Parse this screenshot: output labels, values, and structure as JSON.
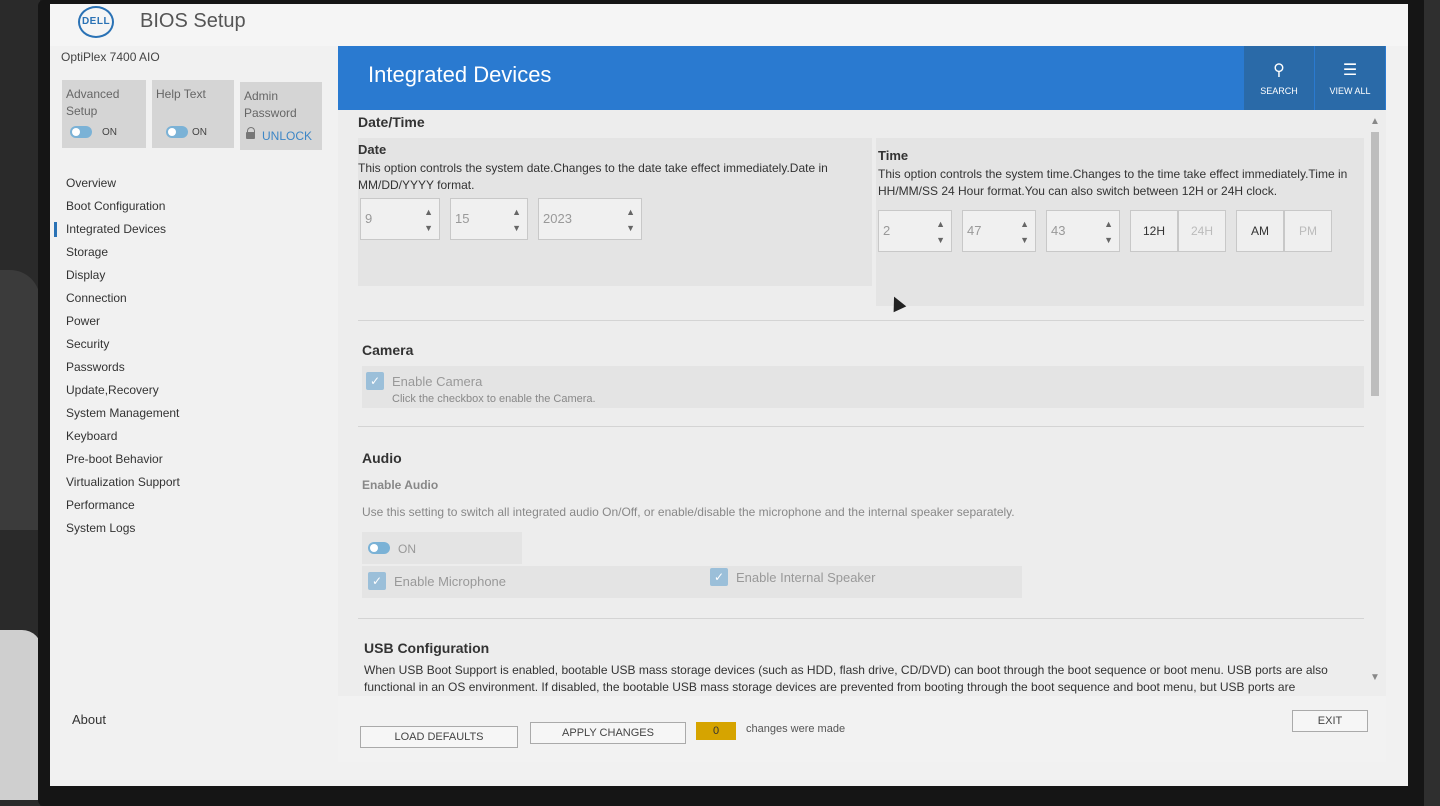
{
  "header": {
    "logo_text": "DELL",
    "title": "BIOS Setup"
  },
  "sidebar": {
    "model": "OptiPlex 7400 AIO",
    "tiles": [
      {
        "label": "Advanced Setup",
        "state": "ON"
      },
      {
        "label": "Help Text",
        "state": "ON"
      },
      {
        "label": "Admin Password",
        "action": "UNLOCK"
      }
    ],
    "items": [
      {
        "label": "Overview"
      },
      {
        "label": "Boot Configuration"
      },
      {
        "label": "Integrated Devices"
      },
      {
        "label": "Storage"
      },
      {
        "label": "Display"
      },
      {
        "label": "Connection"
      },
      {
        "label": "Power"
      },
      {
        "label": "Security"
      },
      {
        "label": "Passwords"
      },
      {
        "label": "Update,Recovery"
      },
      {
        "label": "System Management"
      },
      {
        "label": "Keyboard"
      },
      {
        "label": "Pre-boot Behavior"
      },
      {
        "label": "Virtualization Support"
      },
      {
        "label": "Performance"
      },
      {
        "label": "System Logs"
      }
    ],
    "active_item": "Integrated Devices",
    "about": "About"
  },
  "main": {
    "title": "Integrated Devices",
    "search_label": "SEARCH",
    "view_all_label": "VIEW ALL",
    "datetime": {
      "section_title": "Date/Time",
      "date_title": "Date",
      "date_desc": "This option controls the system date.Changes to the date take effect immediately.Date in MM/DD/YYYY format.",
      "month": "9",
      "day": "15",
      "year": "2023",
      "time_title": "Time",
      "time_desc": "This option controls the system time.Changes to the time take effect immediately.Time in HH/MM/SS 24 Hour format.You can also switch between 12H or 24H clock.",
      "hour": "2",
      "minute": "47",
      "second": "43",
      "fmt_12": "12H",
      "fmt_24": "24H",
      "am": "AM",
      "pm": "PM"
    },
    "camera": {
      "section_title": "Camera",
      "enable_label": "Enable Camera",
      "enable_desc": "Click the checkbox to enable the Camera."
    },
    "audio": {
      "section_title": "Audio",
      "field_title": "Enable Audio",
      "desc": "Use this setting to switch all integrated audio On/Off, or enable/disable the microphone and the internal speaker separately.",
      "toggle_state": "ON",
      "mic_label": "Enable Microphone",
      "speaker_label": "Enable Internal Speaker"
    },
    "usb": {
      "section_title": "USB Configuration",
      "desc_line1": "When USB Boot Support is enabled, bootable USB mass storage devices (such as HDD, flash drive, CD/DVD) can boot through the boot sequence or boot menu. USB ports are also",
      "desc_line2": "functional in an OS environment. If disabled, the bootable USB mass storage devices are prevented from booting through the boot sequence and boot menu, but USB ports are"
    }
  },
  "footer": {
    "load_defaults": "LOAD DEFAULTS",
    "apply_changes": "APPLY CHANGES",
    "change_count": "0",
    "change_text": "changes were made",
    "exit": "EXIT"
  },
  "colors": {
    "header_blue": "#2a7ad0",
    "accent_blue": "#2a72b5",
    "change_badge": "#d6a400"
  }
}
